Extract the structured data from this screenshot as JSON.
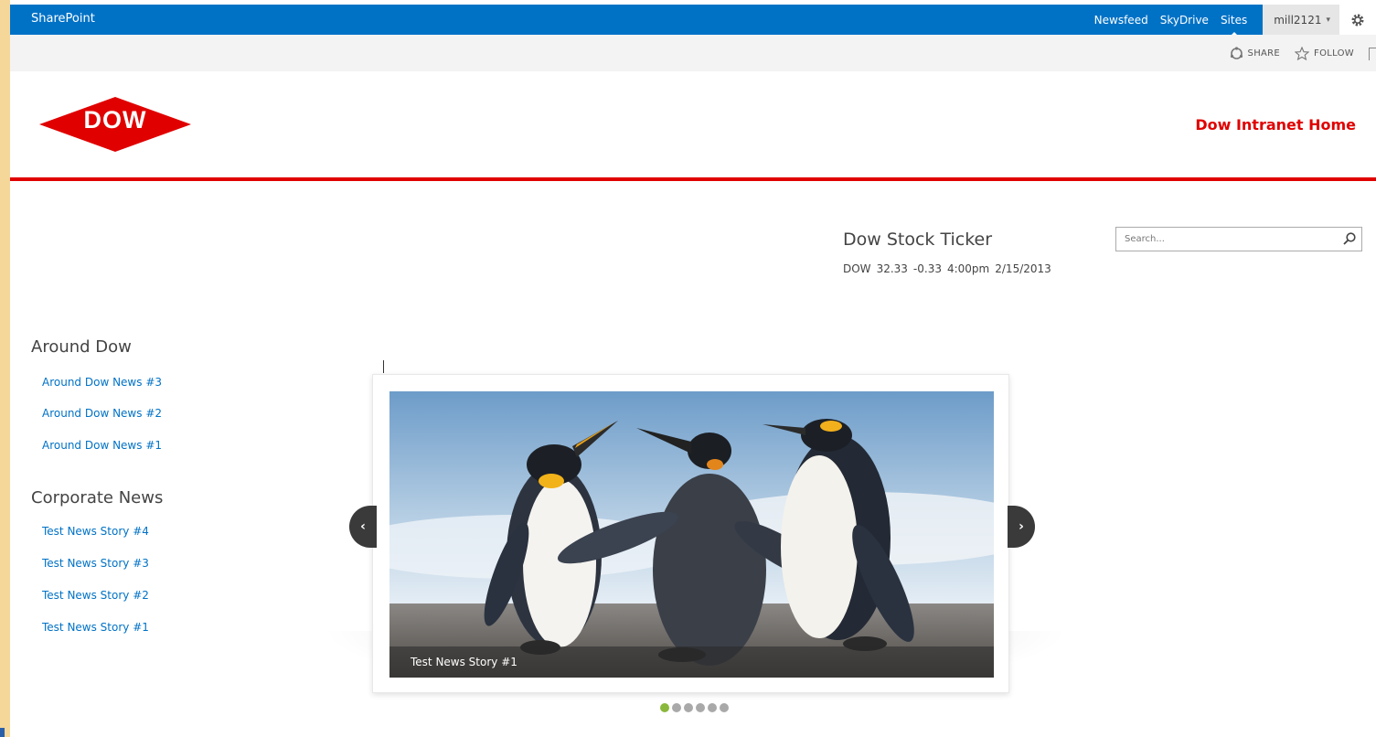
{
  "suitebar": {
    "title": "SharePoint",
    "links": [
      "Newsfeed",
      "SkyDrive",
      "Sites"
    ],
    "user": "mill2121",
    "user_caret": "▾",
    "gear_icon": "gear-icon"
  },
  "ribbon": {
    "share": "SHARE",
    "follow": "FOLLOW"
  },
  "header": {
    "logo_text": "DOW",
    "logo_mark": "®",
    "site_title": "Dow Intranet Home",
    "brand_color": "#e00000",
    "suite_color": "#0072c6"
  },
  "ticker": {
    "title": "Dow Stock Ticker",
    "symbol": "DOW",
    "price": "32.33",
    "change": "-0.33",
    "time": "4:00pm",
    "date": "2/15/2013"
  },
  "search": {
    "placeholder": "Search..."
  },
  "around": {
    "title": "Around Dow",
    "items": [
      "Around Dow News #3",
      "Around Dow News #2",
      "Around Dow News #1"
    ]
  },
  "corporate": {
    "title": "Corporate News",
    "items": [
      "Test News Story #4",
      "Test News Story #3",
      "Test News Story #2",
      "Test News Story #1"
    ]
  },
  "slider": {
    "caption": "Test News Story #1",
    "prev_glyph": "‹",
    "next_glyph": "›",
    "dot_count": 6,
    "active_dot": 1
  }
}
